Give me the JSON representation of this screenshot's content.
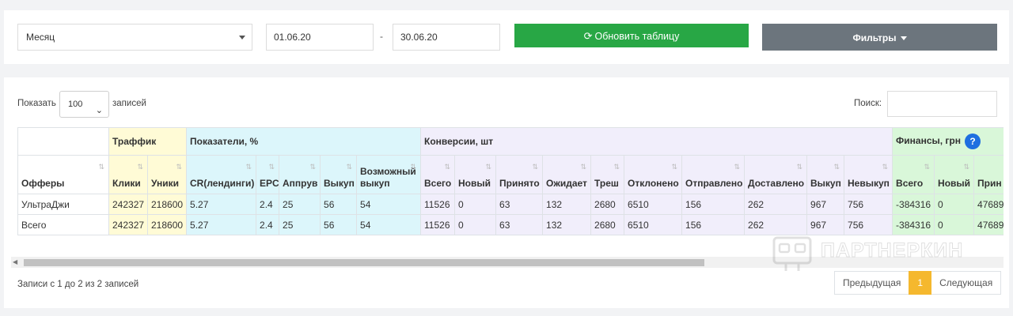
{
  "toolbar": {
    "period_value": "Месяц",
    "date_from": "01.06.20",
    "date_separator": "-",
    "date_to": "30.06.20",
    "refresh_label": "Обновить таблицу",
    "filters_label": "Фильтры"
  },
  "controls": {
    "show_label": "Показать",
    "page_length": "100",
    "records_label": "записей",
    "search_label": "Поиск:",
    "search_value": ""
  },
  "table": {
    "groups": {
      "traffic": "Траффик",
      "indicators": "Показатели, %",
      "conversions": "Конверсии, шт",
      "finance": "Финансы, грн"
    },
    "columns": {
      "offers": "Офферы",
      "clicks": "Клики",
      "uniques": "Уники",
      "cr": "CR(лендинги)",
      "epc": "EPC",
      "approve": "Аппрув",
      "buyout": "Выкуп",
      "possible_buyout": "Возможный выкуп",
      "conv_total": "Всего",
      "conv_new": "Новый",
      "conv_accepted": "Принято",
      "conv_waiting": "Ожидает",
      "conv_trash": "Треш",
      "conv_rejected": "Отклонено",
      "conv_sent": "Отправлено",
      "conv_delivered": "Доставлено",
      "conv_buyout": "Выкуп",
      "conv_nobuyout": "Невыкуп",
      "fin_total": "Всего",
      "fin_new": "Новый",
      "fin_accepted": "Прин"
    },
    "rows": [
      {
        "offer": "УльтраДжи",
        "clicks": "242327",
        "uniques": "218600",
        "cr": "5.27",
        "epc": "2.4",
        "approve": "25",
        "buyout": "56",
        "possible_buyout": "54",
        "conv_total": "11526",
        "conv_new": "0",
        "conv_accepted": "63",
        "conv_waiting": "132",
        "conv_trash": "2680",
        "conv_rejected": "6510",
        "conv_sent": "156",
        "conv_delivered": "262",
        "conv_buyout": "967",
        "conv_nobuyout": "756",
        "fin_total": "-384316",
        "fin_new": "0",
        "fin_accepted": "47689"
      },
      {
        "offer": "Всего",
        "clicks": "242327",
        "uniques": "218600",
        "cr": "5.27",
        "epc": "2.4",
        "approve": "25",
        "buyout": "56",
        "possible_buyout": "54",
        "conv_total": "11526",
        "conv_new": "0",
        "conv_accepted": "63",
        "conv_waiting": "132",
        "conv_trash": "2680",
        "conv_rejected": "6510",
        "conv_sent": "156",
        "conv_delivered": "262",
        "conv_buyout": "967",
        "conv_nobuyout": "756",
        "fin_total": "-384316",
        "fin_new": "0",
        "fin_accepted": "47689"
      }
    ]
  },
  "footer": {
    "info": "Записи с 1 до 2 из 2 записей",
    "prev_label": "Предыдущая",
    "current_page": "1",
    "next_label": "Следующая"
  },
  "watermark": {
    "text": "ПАРТНЕРКИН"
  },
  "colors": {
    "traffic": "#fffbd6",
    "indicators": "#dcf6fb",
    "conversions": "#f1eefb",
    "finance": "#d9f7d9",
    "refresh_button": "#28a745",
    "filters_button": "#6c757d",
    "active_page": "#f5b82e",
    "help_icon": "#1f6fe0"
  },
  "icons": {
    "refresh": "refresh-icon",
    "help": "question-circle-icon",
    "sort": "sort-arrows-icon"
  }
}
